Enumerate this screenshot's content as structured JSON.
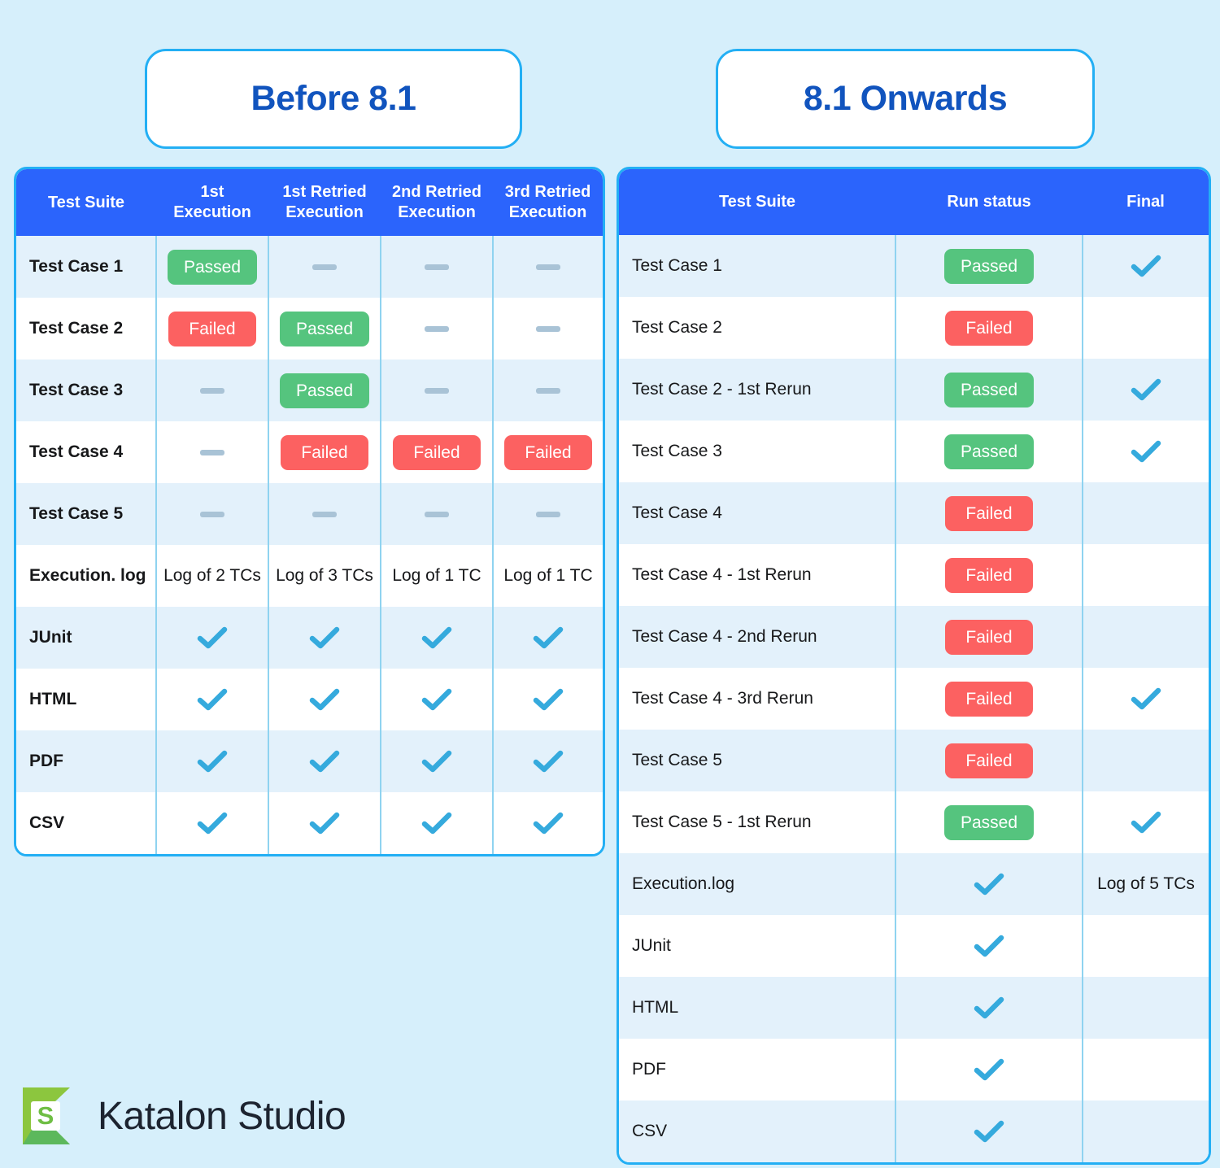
{
  "colors": {
    "background": "#D6EFFB",
    "header_blue": "#2B64FC",
    "title_blue": "#1154BE",
    "card_border": "#23AFF4",
    "row_stripe": "#E3F1FB",
    "passed_green": "#55C47E",
    "failed_red": "#FC6161",
    "check_blue": "#35AADD",
    "dash_grey": "#A9C3D6",
    "logo_green": "#8CC63E",
    "logo_green_dark": "#5CB85C",
    "logo_text": "#1D2430"
  },
  "left_panel": {
    "title": "Before 8.1",
    "columns": [
      "Test Suite",
      "1st\nExecution",
      "1st Retried\nExecution",
      "2nd Retried\nExecution",
      "3rd Retried\nExecution"
    ],
    "rows": [
      {
        "label": "Test Case 1",
        "cells": [
          {
            "type": "badge",
            "text": "Passed",
            "status": "passed"
          },
          {
            "type": "dash"
          },
          {
            "type": "dash"
          },
          {
            "type": "dash"
          }
        ]
      },
      {
        "label": "Test Case 2",
        "cells": [
          {
            "type": "badge",
            "text": "Failed",
            "status": "failed"
          },
          {
            "type": "badge",
            "text": "Passed",
            "status": "passed"
          },
          {
            "type": "dash"
          },
          {
            "type": "dash"
          }
        ]
      },
      {
        "label": "Test Case 3",
        "cells": [
          {
            "type": "dash"
          },
          {
            "type": "badge",
            "text": "Passed",
            "status": "passed"
          },
          {
            "type": "dash"
          },
          {
            "type": "dash"
          }
        ]
      },
      {
        "label": "Test Case 4",
        "cells": [
          {
            "type": "dash"
          },
          {
            "type": "badge",
            "text": "Failed",
            "status": "failed"
          },
          {
            "type": "badge",
            "text": "Failed",
            "status": "failed"
          },
          {
            "type": "badge",
            "text": "Failed",
            "status": "failed"
          }
        ]
      },
      {
        "label": "Test Case 5",
        "cells": [
          {
            "type": "dash"
          },
          {
            "type": "dash"
          },
          {
            "type": "dash"
          },
          {
            "type": "dash"
          }
        ]
      },
      {
        "label": "Execution. log",
        "cells": [
          {
            "type": "text",
            "text": "Log of 2 TCs"
          },
          {
            "type": "text",
            "text": "Log of 3 TCs"
          },
          {
            "type": "text",
            "text": "Log of 1 TC"
          },
          {
            "type": "text",
            "text": "Log of 1 TC"
          }
        ]
      },
      {
        "label": "JUnit",
        "cells": [
          {
            "type": "check"
          },
          {
            "type": "check"
          },
          {
            "type": "check"
          },
          {
            "type": "check"
          }
        ]
      },
      {
        "label": "HTML",
        "cells": [
          {
            "type": "check"
          },
          {
            "type": "check"
          },
          {
            "type": "check"
          },
          {
            "type": "check"
          }
        ]
      },
      {
        "label": "PDF",
        "cells": [
          {
            "type": "check"
          },
          {
            "type": "check"
          },
          {
            "type": "check"
          },
          {
            "type": "check"
          }
        ]
      },
      {
        "label": "CSV",
        "cells": [
          {
            "type": "check"
          },
          {
            "type": "check"
          },
          {
            "type": "check"
          },
          {
            "type": "check"
          }
        ]
      }
    ]
  },
  "right_panel": {
    "title": "8.1 Onwards",
    "columns": [
      "Test Suite",
      "Run status",
      "Final"
    ],
    "rows": [
      {
        "label": "Test Case 1",
        "cells": [
          {
            "type": "badge",
            "text": "Passed",
            "status": "passed"
          },
          {
            "type": "check"
          }
        ]
      },
      {
        "label": "Test Case 2",
        "cells": [
          {
            "type": "badge",
            "text": "Failed",
            "status": "failed"
          },
          {
            "type": "empty"
          }
        ]
      },
      {
        "label": "Test Case 2 - 1st Rerun",
        "cells": [
          {
            "type": "badge",
            "text": "Passed",
            "status": "passed"
          },
          {
            "type": "check"
          }
        ]
      },
      {
        "label": "Test Case 3",
        "cells": [
          {
            "type": "badge",
            "text": "Passed",
            "status": "passed"
          },
          {
            "type": "check"
          }
        ]
      },
      {
        "label": "Test Case 4",
        "cells": [
          {
            "type": "badge",
            "text": "Failed",
            "status": "failed"
          },
          {
            "type": "empty"
          }
        ]
      },
      {
        "label": "Test Case 4 - 1st Rerun",
        "cells": [
          {
            "type": "badge",
            "text": "Failed",
            "status": "failed"
          },
          {
            "type": "empty"
          }
        ]
      },
      {
        "label": "Test Case 4 - 2nd Rerun",
        "cells": [
          {
            "type": "badge",
            "text": "Failed",
            "status": "failed"
          },
          {
            "type": "empty"
          }
        ]
      },
      {
        "label": "Test Case 4 - 3rd Rerun",
        "cells": [
          {
            "type": "badge",
            "text": "Failed",
            "status": "failed"
          },
          {
            "type": "check"
          }
        ]
      },
      {
        "label": "Test Case 5",
        "cells": [
          {
            "type": "badge",
            "text": "Failed",
            "status": "failed"
          },
          {
            "type": "empty"
          }
        ]
      },
      {
        "label": "Test Case 5 - 1st Rerun",
        "cells": [
          {
            "type": "badge",
            "text": "Passed",
            "status": "passed"
          },
          {
            "type": "check"
          }
        ]
      },
      {
        "label": "Execution.log",
        "cells": [
          {
            "type": "check"
          },
          {
            "type": "text",
            "text": "Log of 5 TCs"
          }
        ]
      },
      {
        "label": "JUnit",
        "cells": [
          {
            "type": "check"
          },
          {
            "type": "empty"
          }
        ]
      },
      {
        "label": "HTML",
        "cells": [
          {
            "type": "check"
          },
          {
            "type": "empty"
          }
        ]
      },
      {
        "label": "PDF",
        "cells": [
          {
            "type": "check"
          },
          {
            "type": "empty"
          }
        ]
      },
      {
        "label": "CSV",
        "cells": [
          {
            "type": "check"
          },
          {
            "type": "empty"
          }
        ]
      }
    ]
  },
  "logo": {
    "mark_letter": "S",
    "wordmark": "Katalon Studio"
  }
}
